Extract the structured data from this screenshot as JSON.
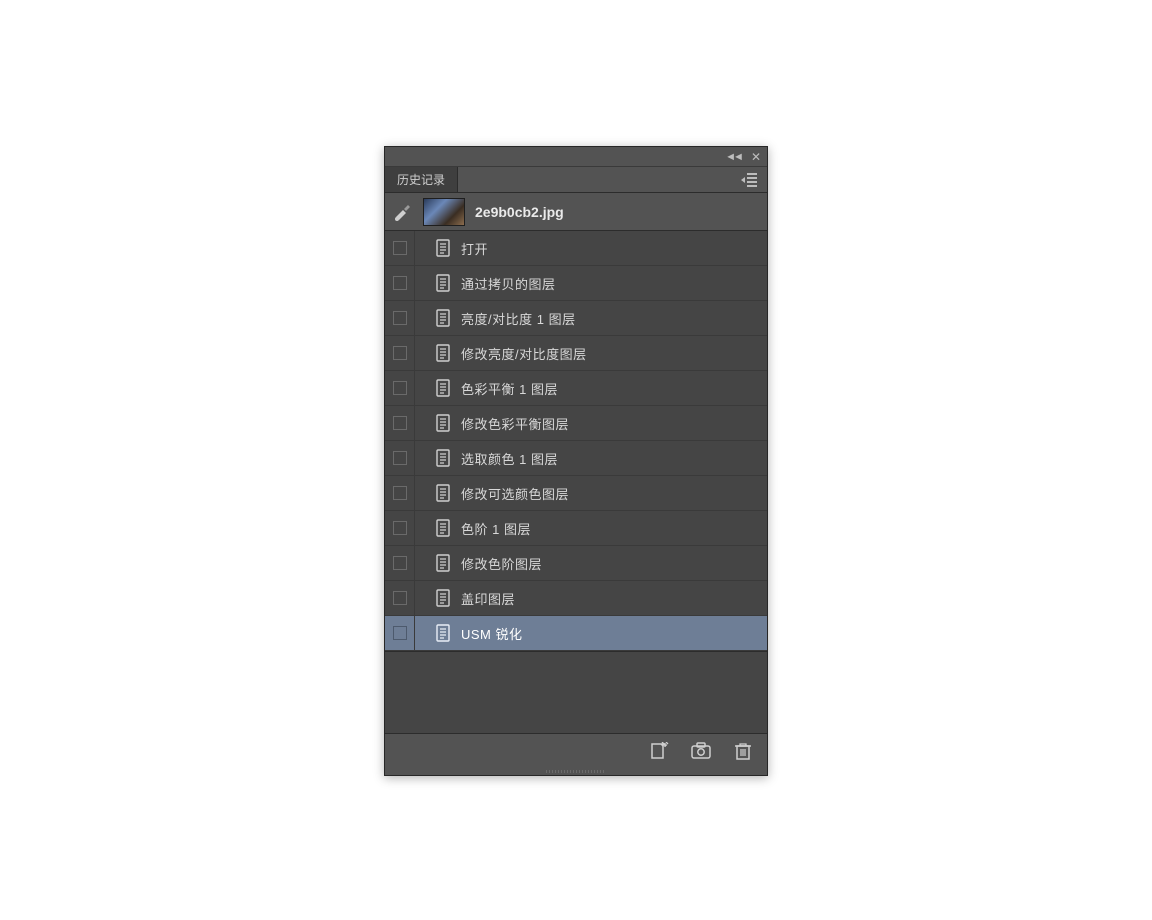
{
  "panel": {
    "tab_title": "历史记录",
    "document_name": "2e9b0cb2.jpg"
  },
  "history": {
    "items": [
      {
        "label": "打开",
        "selected": false
      },
      {
        "label": "通过拷贝的图层",
        "selected": false
      },
      {
        "label": "亮度/对比度 1 图层",
        "selected": false
      },
      {
        "label": "修改亮度/对比度图层",
        "selected": false
      },
      {
        "label": "色彩平衡 1 图层",
        "selected": false
      },
      {
        "label": "修改色彩平衡图层",
        "selected": false
      },
      {
        "label": "选取颜色 1 图层",
        "selected": false
      },
      {
        "label": "修改可选颜色图层",
        "selected": false
      },
      {
        "label": "色阶 1 图层",
        "selected": false
      },
      {
        "label": "修改色阶图层",
        "selected": false
      },
      {
        "label": "盖印图层",
        "selected": false
      },
      {
        "label": "USM 锐化",
        "selected": true
      }
    ]
  },
  "icons": {
    "brush": "history-brush-icon",
    "step": "document-icon",
    "new_from_state": "new-document-icon",
    "snapshot": "camera-icon",
    "delete": "trash-icon",
    "menu": "panel-menu-icon",
    "collapse": "collapse-icon",
    "close": "close-icon"
  }
}
